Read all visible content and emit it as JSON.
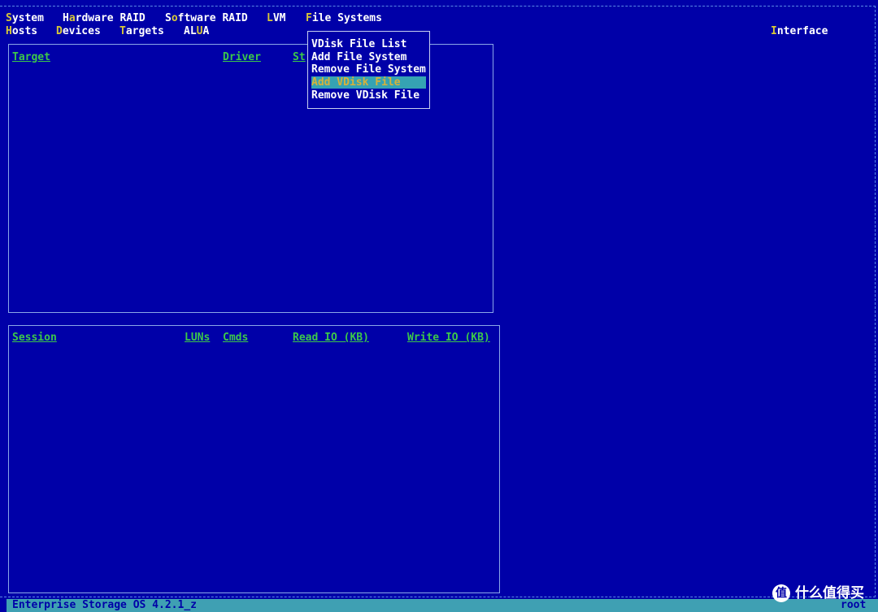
{
  "menubar": {
    "row1": [
      {
        "hk": "S",
        "rest": "ystem"
      },
      {
        "pre": "H",
        "hk": "a",
        "rest": "rdware RAID"
      },
      {
        "pre": "S",
        "hk": "o",
        "rest": "ftware RAID"
      },
      {
        "hk": "L",
        "rest": "VM"
      },
      {
        "hk": "F",
        "rest": "ile Systems"
      }
    ],
    "row2": [
      {
        "hk": "H",
        "rest": "osts"
      },
      {
        "hk": "D",
        "rest": "evices"
      },
      {
        "hk": "T",
        "rest": "argets"
      },
      {
        "pre": "AL",
        "hk": "U",
        "rest": "A"
      }
    ],
    "interface": {
      "hk": "I",
      "rest": "nterface"
    }
  },
  "targets_panel": {
    "headers": [
      "Target",
      "Driver",
      "St"
    ]
  },
  "sessions_panel": {
    "headers": [
      "Session",
      "LUNs",
      "Cmds",
      "Read IO (KB)",
      "Write IO (KB)"
    ]
  },
  "file_systems_menu": {
    "items": [
      "VDisk File List",
      "Add File System",
      "Remove File System",
      "Add VDisk File",
      "Remove VDisk File"
    ],
    "selected_index": 3
  },
  "status_bar": {
    "left": "Enterprise Storage OS 4.2.1_z",
    "right": "root"
  },
  "watermark": {
    "glyph": "值",
    "text": "什么值得买"
  },
  "colors": {
    "background": "#0000a8",
    "hotkey": "#d8c838",
    "header": "#3cc84a",
    "selection": "#35a3b3",
    "status_bar": "#3fa0b3"
  }
}
